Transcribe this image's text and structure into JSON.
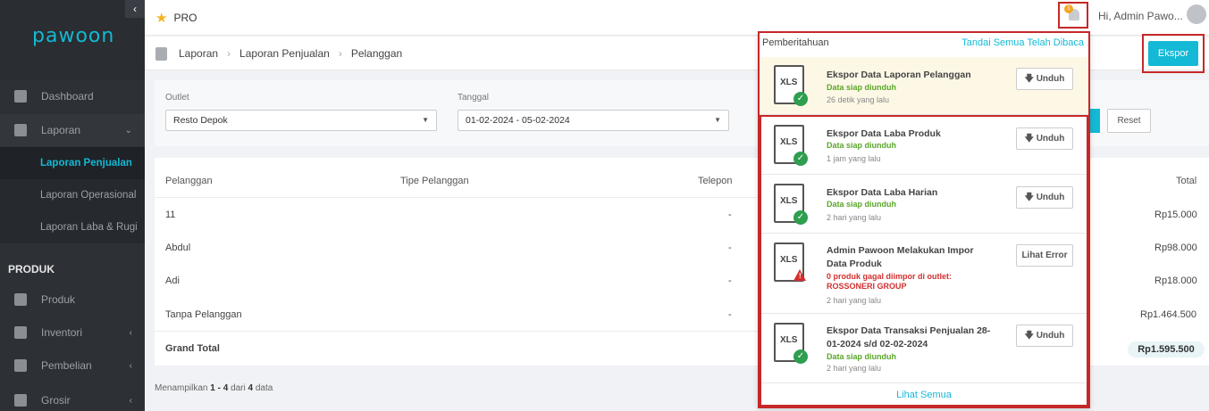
{
  "sidebar": {
    "logo": "pawoon",
    "items": [
      {
        "label": "Dashboard"
      },
      {
        "label": "Laporan"
      },
      {
        "label": "Laporan Penjualan"
      },
      {
        "label": "Laporan Operasional"
      },
      {
        "label": "Laporan Laba & Rugi"
      },
      {
        "label": "Produk"
      },
      {
        "label": "Inventori"
      },
      {
        "label": "Pembelian"
      },
      {
        "label": "Grosir"
      }
    ],
    "section_produk": "PRODUK"
  },
  "topbar": {
    "plan": "PRO",
    "bell_badge": "1",
    "greeting": "Hi, Admin Pawo..."
  },
  "breadcrumb": [
    "Laporan",
    "Laporan Penjualan",
    "Pelanggan"
  ],
  "export_label": "Ekspor",
  "filters": {
    "outlet_label": "Outlet",
    "outlet_value": "Resto Depok",
    "date_label": "Tanggal",
    "date_value": "01-02-2024 - 05-02-2024",
    "reset_label": "Reset"
  },
  "table": {
    "headers": [
      "Pelanggan",
      "Tipe Pelanggan",
      "Telepon",
      "Total"
    ],
    "rows": [
      {
        "name": "11",
        "phone": "-",
        "total": "Rp15.000"
      },
      {
        "name": "Abdul",
        "phone": "-",
        "total": "Rp98.000"
      },
      {
        "name": "Adi",
        "phone": "-",
        "total": "Rp18.000"
      },
      {
        "name": "Tanpa Pelanggan",
        "phone": "-",
        "total": "Rp1.464.500"
      }
    ],
    "grand_total_label": "Grand Total",
    "grand_total_value": "Rp1.595.500",
    "footer_prefix": "Menampilkan",
    "footer_range": "1 - 4",
    "footer_mid": "dari",
    "footer_count": "4",
    "footer_suffix": "data"
  },
  "notifications": {
    "title": "Pemberitahuan",
    "mark_all": "Tandai Semua Telah Dibaca",
    "see_all": "Lihat Semua",
    "items": [
      {
        "file": "XLS",
        "title": "Ekspor Data Laporan Pelanggan",
        "status": "Data siap diunduh",
        "time": "26 detik yang lalu",
        "action": "Unduh"
      },
      {
        "file": "XLS",
        "title": "Ekspor Data Laba Produk",
        "status": "Data siap diunduh",
        "time": "1 jam yang lalu",
        "action": "Unduh"
      },
      {
        "file": "XLS",
        "title": "Ekspor Data Laba Harian",
        "status": "Data siap diunduh",
        "time": "2 hari yang lalu",
        "action": "Unduh"
      },
      {
        "file": "XLS",
        "title": "Admin Pawoon Melakukan Impor Data Produk",
        "status": "0 produk gagal diimpor di outlet: ROSSONERI GROUP",
        "time": "2 hari yang lalu",
        "action": "Lihat Error"
      },
      {
        "file": "XLS",
        "title": "Ekspor Data Transaksi Penjualan 28-01-2024 s/d 02-02-2024",
        "status": "Data siap diunduh",
        "time": "2 hari yang lalu",
        "action": "Unduh"
      }
    ]
  },
  "colors": {
    "accent": "#13b9d5",
    "sidebar": "#2d3035",
    "highlight": "#c62828",
    "success": "#5aa629"
  }
}
